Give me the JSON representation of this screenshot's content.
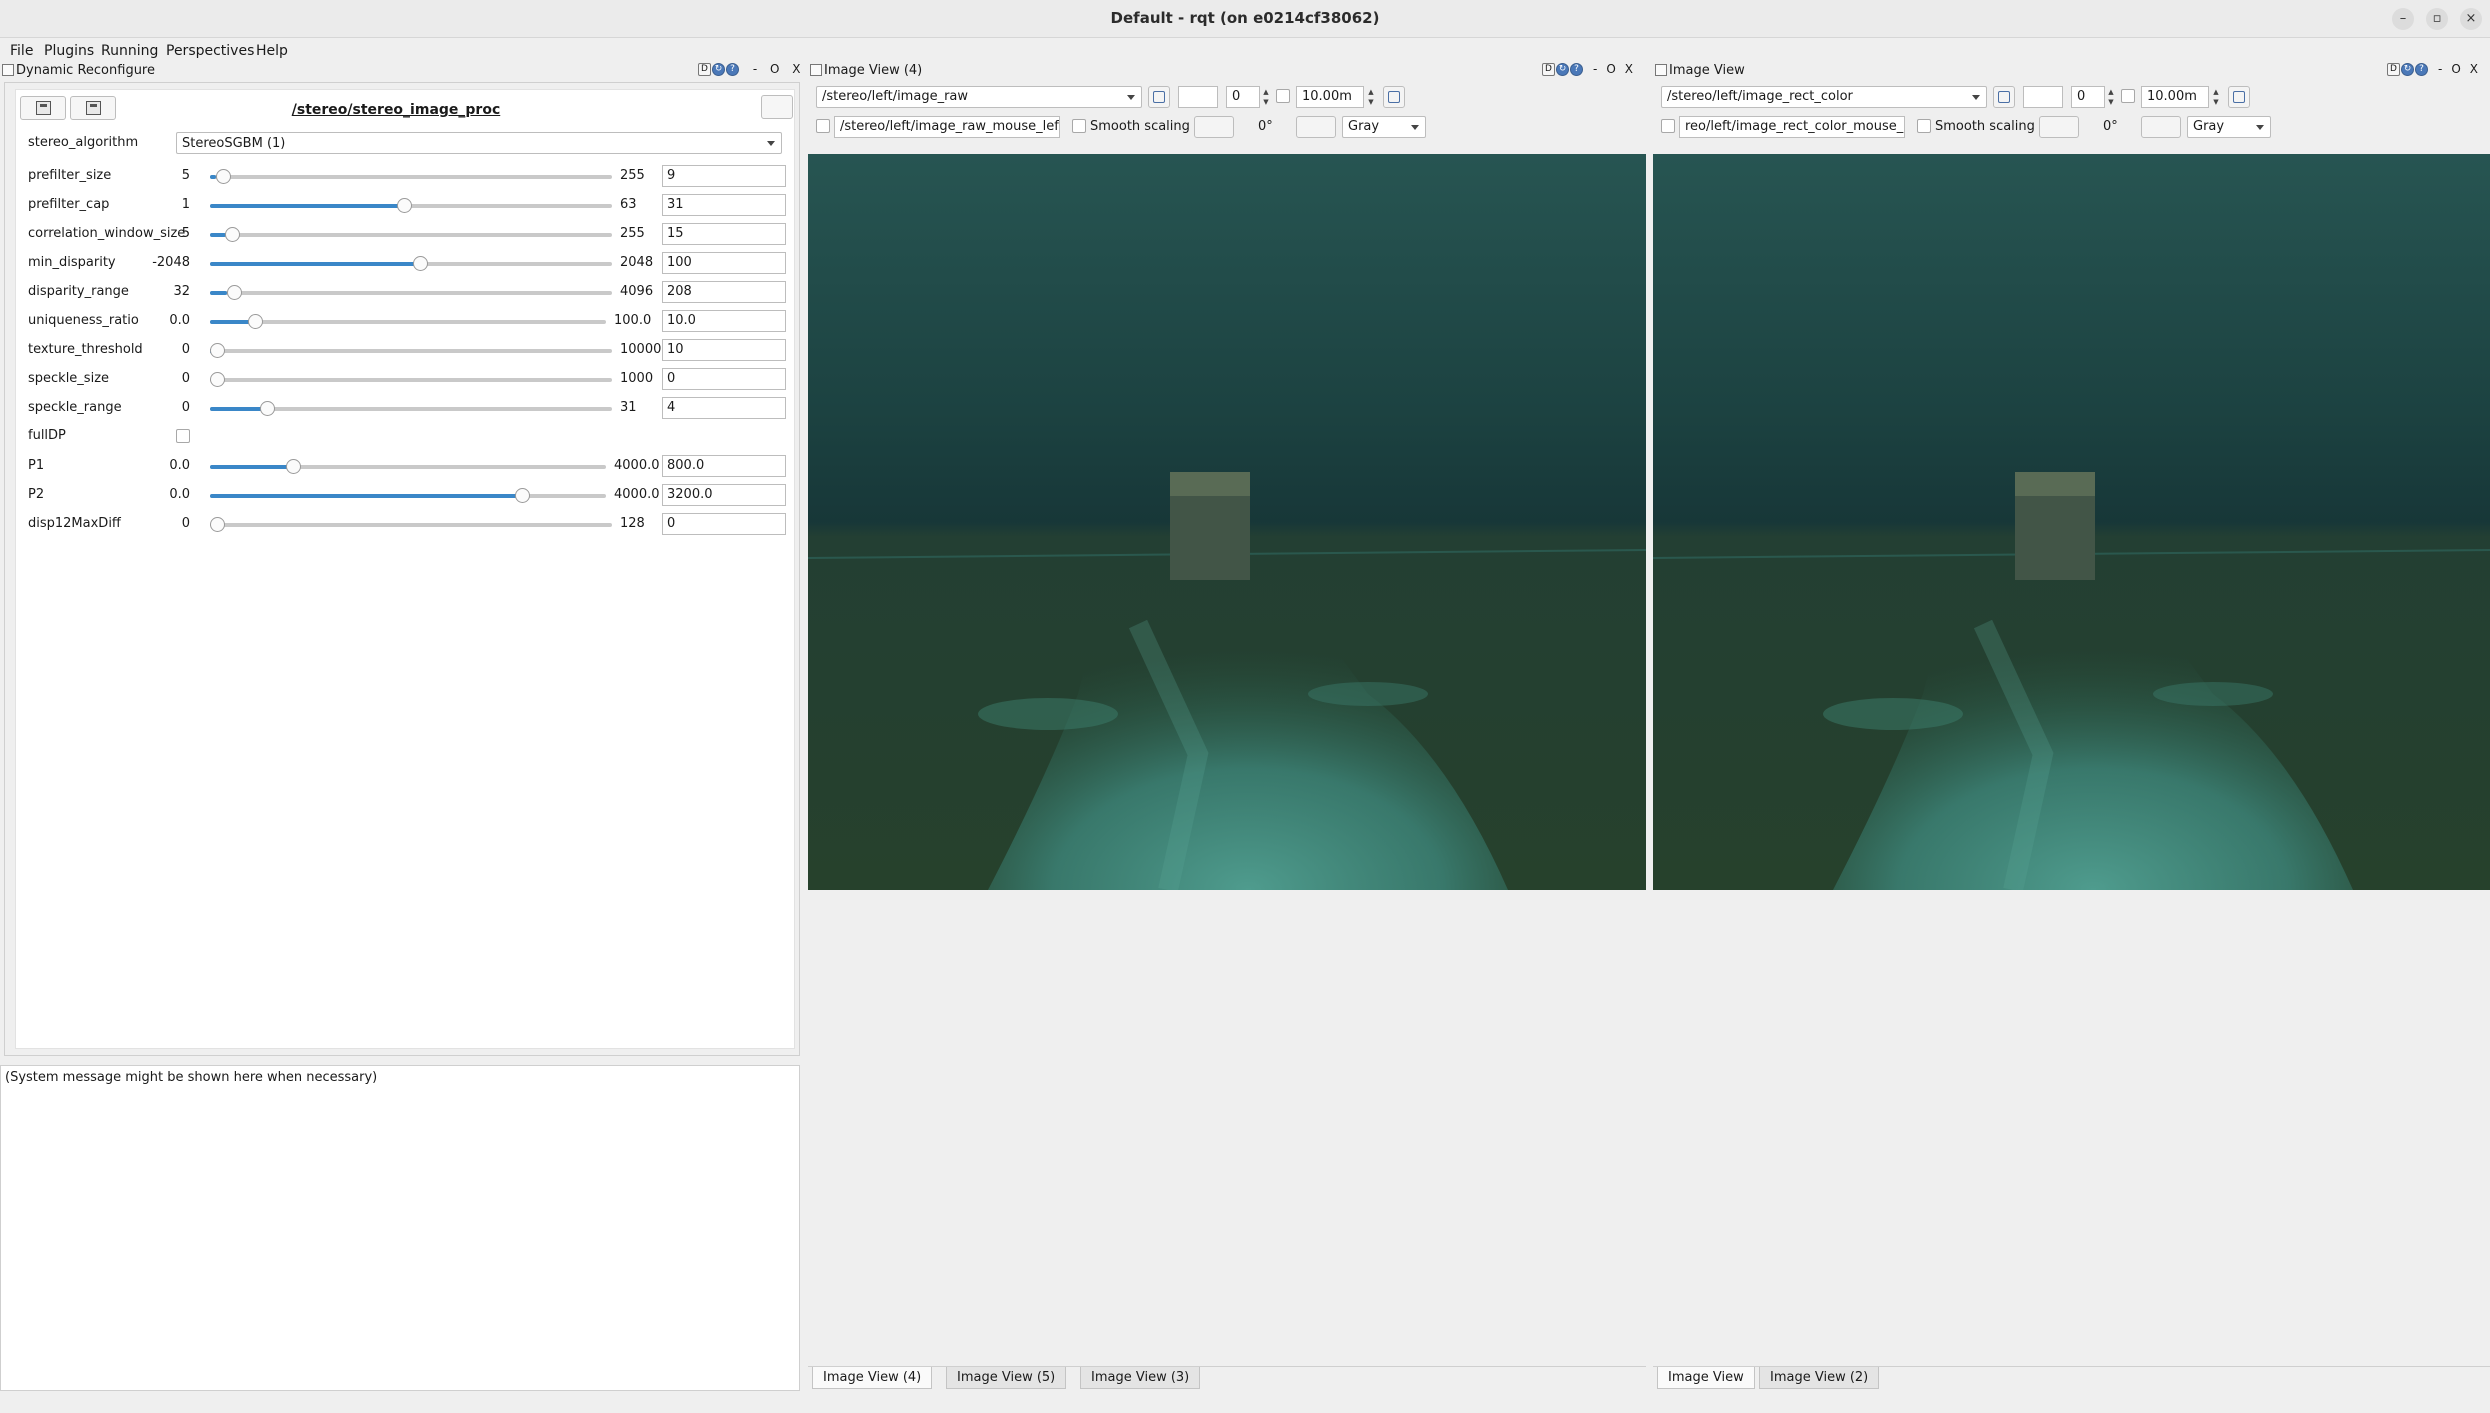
{
  "window": {
    "title": "Default - rqt (on e0214cf38062)"
  },
  "menu": [
    {
      "label": "File",
      "key": "F"
    },
    {
      "label": "Plugins",
      "key": "P"
    },
    {
      "label": "Running",
      "key": "R"
    },
    {
      "label": "Perspectives",
      "key": "P"
    },
    {
      "label": "Help",
      "key": "H"
    }
  ],
  "dock_controls": {
    "d": "D",
    "dash": "-",
    "o": "O",
    "x": "X"
  },
  "reconfigure": {
    "dock_title": "Dynamic Reconfigure",
    "node": "/stereo/stereo_image_proc",
    "stereo_algorithm": {
      "label": "stereo_algorithm",
      "value": "StereoSGBM (1)"
    },
    "params": [
      {
        "name": "prefilter_size",
        "min": "5",
        "max": "255",
        "value": "9",
        "frac": 0.016
      },
      {
        "name": "prefilter_cap",
        "min": "1",
        "max": "63",
        "value": "31",
        "frac": 0.484
      },
      {
        "name": "correlation_window_size",
        "min": "5",
        "max": "255",
        "value": "15",
        "frac": 0.04
      },
      {
        "name": "min_disparity",
        "min": "-2048",
        "max": "2048",
        "value": "100",
        "frac": 0.524
      },
      {
        "name": "disparity_range",
        "min": "32",
        "max": "4096",
        "value": "208",
        "frac": 0.043
      },
      {
        "name": "uniqueness_ratio",
        "min": "0.0",
        "max": "100.0",
        "value": "10.0",
        "frac": 0.1
      },
      {
        "name": "texture_threshold",
        "min": "0",
        "max": "10000",
        "value": "10",
        "frac": 0.001
      },
      {
        "name": "speckle_size",
        "min": "0",
        "max": "1000",
        "value": "0",
        "frac": 0.0
      },
      {
        "name": "speckle_range",
        "min": "0",
        "max": "31",
        "value": "4",
        "frac": 0.129
      }
    ],
    "fullDP": {
      "name": "fullDP",
      "checked": false
    },
    "params2": [
      {
        "name": "P1",
        "min": "0.0",
        "max": "4000.0",
        "value": "800.0",
        "frac": 0.2
      },
      {
        "name": "P2",
        "min": "0.0",
        "max": "4000.0",
        "value": "3200.0",
        "frac": 0.8
      },
      {
        "name": "disp12MaxDiff",
        "min": "0",
        "max": "128",
        "value": "0",
        "frac": 0.0
      }
    ]
  },
  "system_message": "(System message might be shown here when necessary)",
  "image_views": [
    {
      "dock_title": "Image View (4)",
      "topic": "/stereo/left/image_raw",
      "num_value": "0",
      "range_value": "10.00m",
      "mouse_topic": "/stereo/left/image_raw_mouse_left",
      "smooth_label": "Smooth scaling",
      "rotation": "0°",
      "colormap": "Gray",
      "tabs": [
        "Image View (4)",
        "Image View (5)",
        "Image View (3)"
      ],
      "active_tab": 0
    },
    {
      "dock_title": "Image View",
      "topic": "/stereo/left/image_rect_color",
      "num_value": "0",
      "range_value": "10.00m",
      "mouse_topic": "reo/left/image_rect_color_mouse_left",
      "smooth_label": "Smooth scaling",
      "rotation": "0°",
      "colormap": "Gray",
      "tabs": [
        "Image View",
        "Image View (2)"
      ],
      "active_tab": 0
    }
  ],
  "colors": {
    "slider_fill": "#3a87c8",
    "water_dark": "#1a3c3b",
    "water_floor": "#3f8b7e"
  }
}
